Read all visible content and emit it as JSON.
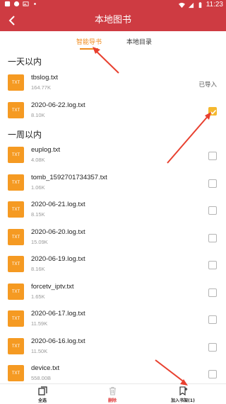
{
  "status_bar": {
    "time": "11:23",
    "left_icons": [
      "app-icon",
      "app-icon",
      "image-icon",
      "dot-icon"
    ],
    "right_icons": [
      "wifi-icon",
      "signal-icon",
      "battery-icon"
    ]
  },
  "header": {
    "title": "本地图书",
    "back_icon": "chevron-left-icon"
  },
  "tabs": [
    {
      "label": "智能导书",
      "active": true
    },
    {
      "label": "本地目录",
      "active": false
    }
  ],
  "sections": [
    {
      "title": "一天以内",
      "files": [
        {
          "icon_label": "TXT",
          "name": "tbslog.txt",
          "size": "164.77K",
          "status": "已导入",
          "checked": false
        },
        {
          "icon_label": "TXT",
          "name": "2020-06-22.log.txt",
          "size": "8.10K",
          "status": "",
          "checked": true
        }
      ]
    },
    {
      "title": "一周以内",
      "files": [
        {
          "icon_label": "TXT",
          "name": "euplog.txt",
          "size": "4.08K",
          "status": "",
          "checked": false
        },
        {
          "icon_label": "TXT",
          "name": "tomb_1592701734357.txt",
          "size": "1.06K",
          "status": "",
          "checked": false
        },
        {
          "icon_label": "TXT",
          "name": "2020-06-21.log.txt",
          "size": "8.15K",
          "status": "",
          "checked": false
        },
        {
          "icon_label": "TXT",
          "name": "2020-06-20.log.txt",
          "size": "15.09K",
          "status": "",
          "checked": false
        },
        {
          "icon_label": "TXT",
          "name": "2020-06-19.log.txt",
          "size": "8.16K",
          "status": "",
          "checked": false
        },
        {
          "icon_label": "TXT",
          "name": "forcetv_iptv.txt",
          "size": "1.65K",
          "status": "",
          "checked": false
        },
        {
          "icon_label": "TXT",
          "name": "2020-06-17.log.txt",
          "size": "11.59K",
          "status": "",
          "checked": false
        },
        {
          "icon_label": "TXT",
          "name": "2020-06-16.log.txt",
          "size": "11.50K",
          "status": "",
          "checked": false
        },
        {
          "icon_label": "TXT",
          "name": "device.txt",
          "size": "558.00B",
          "status": "",
          "checked": false
        }
      ]
    }
  ],
  "bottom_bar": [
    {
      "label": "全选",
      "icon": "select-all-icon",
      "color": "#222222"
    },
    {
      "label": "删除",
      "icon": "trash-icon",
      "color": "#e03a3a"
    },
    {
      "label": "加入书架(1)",
      "icon": "add-to-shelf-icon",
      "color": "#222222"
    }
  ],
  "colors": {
    "header_bg": "#ce3b42",
    "accent": "#f08a1a",
    "file_icon": "#f59a22",
    "checkbox_checked": "#f5b82e",
    "annotation_arrow": "#e8402f"
  }
}
